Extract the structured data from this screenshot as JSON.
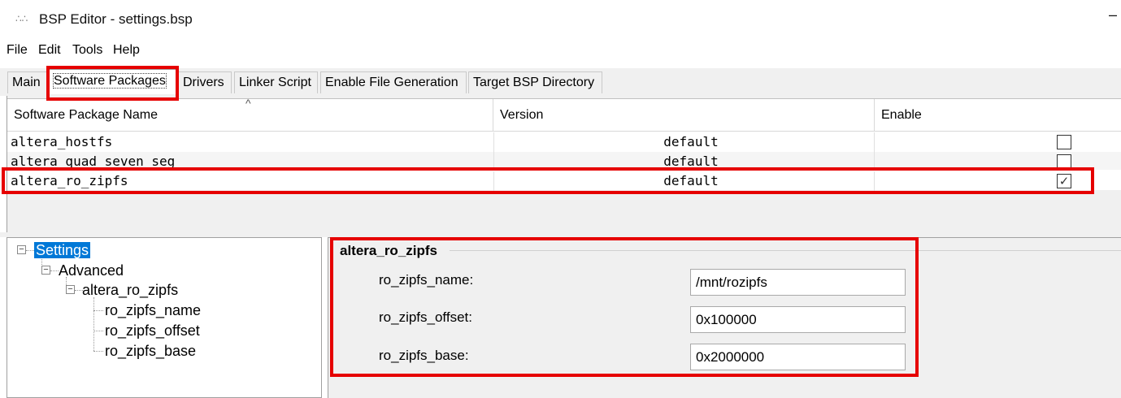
{
  "window": {
    "title": "BSP Editor - settings.bsp",
    "app_icon": "bsp-app-icon",
    "minimize_glyph": "–"
  },
  "menu": [
    "File",
    "Edit",
    "Tools",
    "Help"
  ],
  "tabs": [
    {
      "label": "Main",
      "active": false
    },
    {
      "label": "Software Packages",
      "active": true
    },
    {
      "label": "Drivers",
      "active": false
    },
    {
      "label": "Linker Script",
      "active": false
    },
    {
      "label": "Enable File Generation",
      "active": false
    },
    {
      "label": "Target BSP Directory",
      "active": false
    }
  ],
  "packages": {
    "columns": [
      "Software Package Name",
      "Version",
      "Enable"
    ],
    "sort_indicator": "^",
    "rows": [
      {
        "name": "altera_hostfs",
        "version": "default",
        "enabled": false
      },
      {
        "name": "altera_quad_seven_seg",
        "version": "default",
        "enabled": false
      },
      {
        "name": "altera_ro_zipfs",
        "version": "default",
        "enabled": true
      }
    ]
  },
  "tree": {
    "root": "Settings",
    "advanced": "Advanced",
    "package": "altera_ro_zipfs",
    "leaves": [
      "ro_zipfs_name",
      "ro_zipfs_offset",
      "ro_zipfs_base"
    ],
    "expand_glyph": "−"
  },
  "details": {
    "group_title": "altera_ro_zipfs",
    "fields": [
      {
        "label": "ro_zipfs_name:",
        "value": "/mnt/rozipfs"
      },
      {
        "label": "ro_zipfs_offset:",
        "value": "0x100000"
      },
      {
        "label": "ro_zipfs_base:",
        "value": "0x2000000"
      }
    ]
  },
  "colors": {
    "highlight": "#e60000",
    "selection": "#0078d7",
    "panel_bg": "#f0f0f0"
  }
}
